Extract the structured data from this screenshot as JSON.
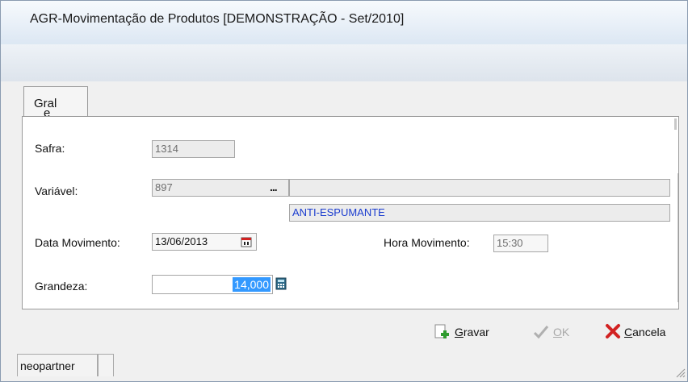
{
  "window": {
    "title": "AGR-Movimentação de Produtos [DEMONSTRAÇÃO - Set/2010]"
  },
  "toolbar": {
    "icons": [
      "undo-icon",
      "redo-icon",
      "new-document-icon",
      "cut-icon",
      "copy-icon",
      "paste-icon",
      "info-icon",
      "tools-icon"
    ]
  },
  "tabs": [
    {
      "label": "Geral",
      "accel": "e"
    }
  ],
  "form": {
    "safra": {
      "label": "Safra:",
      "value": "1314"
    },
    "variavel": {
      "label": "Variável:",
      "code": "897",
      "ellipsis": "...",
      "description": "ANTI-ESPUMANTE"
    },
    "data_movimento": {
      "label": "Data Movimento:",
      "value": "13/06/2013"
    },
    "hora_movimento": {
      "label": "Hora Movimento:",
      "value": "15:30"
    },
    "grandeza": {
      "label": "Grandeza:",
      "value": "14,000"
    }
  },
  "buttons": {
    "gravar": {
      "label": "Gravar",
      "accel": "G"
    },
    "ok": {
      "label": "OK",
      "accel": "O"
    },
    "cancela": {
      "label": "Cancela",
      "accel": "C"
    }
  },
  "status": {
    "user": "neopartner"
  },
  "colors": {
    "accent": "#3399ff",
    "link_text": "#1a3ccf",
    "cancel_red": "#d22222",
    "gravar_green": "#2e9b2e"
  }
}
